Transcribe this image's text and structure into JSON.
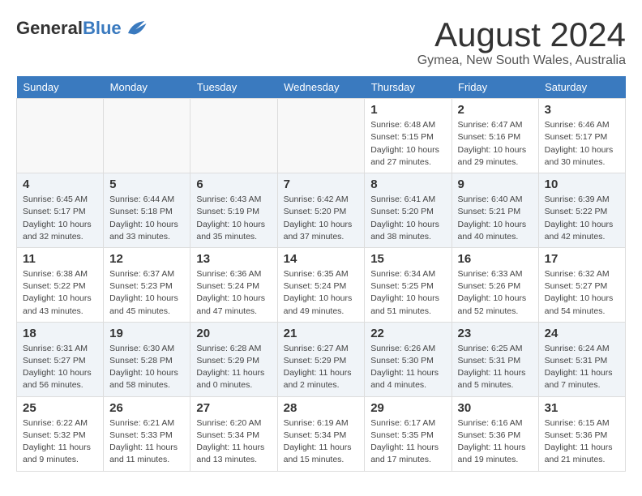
{
  "header": {
    "logo_general": "General",
    "logo_blue": "Blue",
    "month_title": "August 2024",
    "location": "Gymea, New South Wales, Australia"
  },
  "days_of_week": [
    "Sunday",
    "Monday",
    "Tuesday",
    "Wednesday",
    "Thursday",
    "Friday",
    "Saturday"
  ],
  "weeks": [
    [
      {
        "day": "",
        "info": ""
      },
      {
        "day": "",
        "info": ""
      },
      {
        "day": "",
        "info": ""
      },
      {
        "day": "",
        "info": ""
      },
      {
        "day": "1",
        "info": "Sunrise: 6:48 AM\nSunset: 5:15 PM\nDaylight: 10 hours\nand 27 minutes."
      },
      {
        "day": "2",
        "info": "Sunrise: 6:47 AM\nSunset: 5:16 PM\nDaylight: 10 hours\nand 29 minutes."
      },
      {
        "day": "3",
        "info": "Sunrise: 6:46 AM\nSunset: 5:17 PM\nDaylight: 10 hours\nand 30 minutes."
      }
    ],
    [
      {
        "day": "4",
        "info": "Sunrise: 6:45 AM\nSunset: 5:17 PM\nDaylight: 10 hours\nand 32 minutes."
      },
      {
        "day": "5",
        "info": "Sunrise: 6:44 AM\nSunset: 5:18 PM\nDaylight: 10 hours\nand 33 minutes."
      },
      {
        "day": "6",
        "info": "Sunrise: 6:43 AM\nSunset: 5:19 PM\nDaylight: 10 hours\nand 35 minutes."
      },
      {
        "day": "7",
        "info": "Sunrise: 6:42 AM\nSunset: 5:20 PM\nDaylight: 10 hours\nand 37 minutes."
      },
      {
        "day": "8",
        "info": "Sunrise: 6:41 AM\nSunset: 5:20 PM\nDaylight: 10 hours\nand 38 minutes."
      },
      {
        "day": "9",
        "info": "Sunrise: 6:40 AM\nSunset: 5:21 PM\nDaylight: 10 hours\nand 40 minutes."
      },
      {
        "day": "10",
        "info": "Sunrise: 6:39 AM\nSunset: 5:22 PM\nDaylight: 10 hours\nand 42 minutes."
      }
    ],
    [
      {
        "day": "11",
        "info": "Sunrise: 6:38 AM\nSunset: 5:22 PM\nDaylight: 10 hours\nand 43 minutes."
      },
      {
        "day": "12",
        "info": "Sunrise: 6:37 AM\nSunset: 5:23 PM\nDaylight: 10 hours\nand 45 minutes."
      },
      {
        "day": "13",
        "info": "Sunrise: 6:36 AM\nSunset: 5:24 PM\nDaylight: 10 hours\nand 47 minutes."
      },
      {
        "day": "14",
        "info": "Sunrise: 6:35 AM\nSunset: 5:24 PM\nDaylight: 10 hours\nand 49 minutes."
      },
      {
        "day": "15",
        "info": "Sunrise: 6:34 AM\nSunset: 5:25 PM\nDaylight: 10 hours\nand 51 minutes."
      },
      {
        "day": "16",
        "info": "Sunrise: 6:33 AM\nSunset: 5:26 PM\nDaylight: 10 hours\nand 52 minutes."
      },
      {
        "day": "17",
        "info": "Sunrise: 6:32 AM\nSunset: 5:27 PM\nDaylight: 10 hours\nand 54 minutes."
      }
    ],
    [
      {
        "day": "18",
        "info": "Sunrise: 6:31 AM\nSunset: 5:27 PM\nDaylight: 10 hours\nand 56 minutes."
      },
      {
        "day": "19",
        "info": "Sunrise: 6:30 AM\nSunset: 5:28 PM\nDaylight: 10 hours\nand 58 minutes."
      },
      {
        "day": "20",
        "info": "Sunrise: 6:28 AM\nSunset: 5:29 PM\nDaylight: 11 hours\nand 0 minutes."
      },
      {
        "day": "21",
        "info": "Sunrise: 6:27 AM\nSunset: 5:29 PM\nDaylight: 11 hours\nand 2 minutes."
      },
      {
        "day": "22",
        "info": "Sunrise: 6:26 AM\nSunset: 5:30 PM\nDaylight: 11 hours\nand 4 minutes."
      },
      {
        "day": "23",
        "info": "Sunrise: 6:25 AM\nSunset: 5:31 PM\nDaylight: 11 hours\nand 5 minutes."
      },
      {
        "day": "24",
        "info": "Sunrise: 6:24 AM\nSunset: 5:31 PM\nDaylight: 11 hours\nand 7 minutes."
      }
    ],
    [
      {
        "day": "25",
        "info": "Sunrise: 6:22 AM\nSunset: 5:32 PM\nDaylight: 11 hours\nand 9 minutes."
      },
      {
        "day": "26",
        "info": "Sunrise: 6:21 AM\nSunset: 5:33 PM\nDaylight: 11 hours\nand 11 minutes."
      },
      {
        "day": "27",
        "info": "Sunrise: 6:20 AM\nSunset: 5:34 PM\nDaylight: 11 hours\nand 13 minutes."
      },
      {
        "day": "28",
        "info": "Sunrise: 6:19 AM\nSunset: 5:34 PM\nDaylight: 11 hours\nand 15 minutes."
      },
      {
        "day": "29",
        "info": "Sunrise: 6:17 AM\nSunset: 5:35 PM\nDaylight: 11 hours\nand 17 minutes."
      },
      {
        "day": "30",
        "info": "Sunrise: 6:16 AM\nSunset: 5:36 PM\nDaylight: 11 hours\nand 19 minutes."
      },
      {
        "day": "31",
        "info": "Sunrise: 6:15 AM\nSunset: 5:36 PM\nDaylight: 11 hours\nand 21 minutes."
      }
    ]
  ]
}
